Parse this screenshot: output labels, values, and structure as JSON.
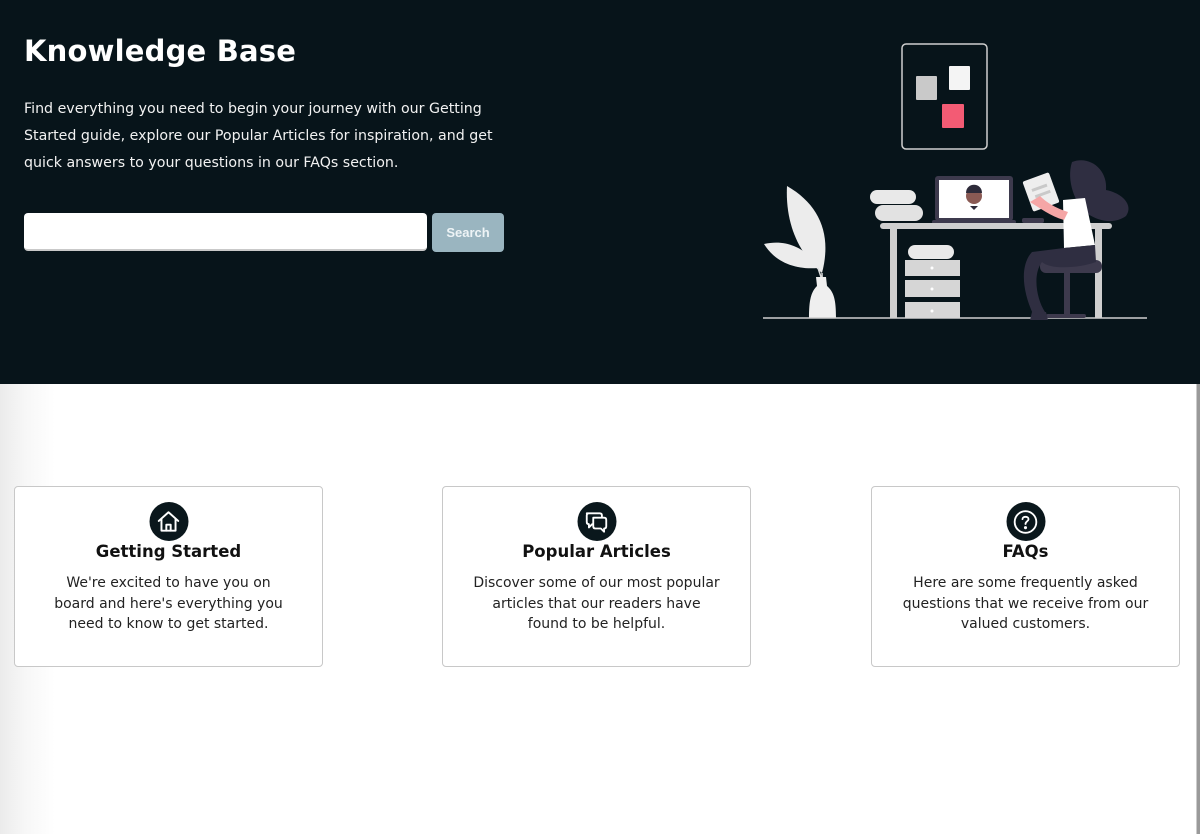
{
  "hero": {
    "title": "Knowledge Base",
    "description": "Find everything you need to begin your journey with our Getting Started guide, explore our Popular Articles for inspiration, and get quick answers to your questions in our FAQs section.",
    "search": {
      "value": "",
      "placeholder": "",
      "button_label": "Search"
    },
    "illustration": "person-working-at-desk-illustration"
  },
  "colors": {
    "hero_bg": "#07141a",
    "search_button_bg": "#9ab5c0",
    "accent_pink": "#f35b74",
    "icon_circle": "#0a171c"
  },
  "cards": [
    {
      "icon": "home-icon",
      "title": "Getting Started",
      "description": "We're excited to have you on board and here's everything you need to know to get started."
    },
    {
      "icon": "chat-bubbles-icon",
      "title": "Popular Articles",
      "description": "Discover some of our most popular articles that our readers have found to be helpful."
    },
    {
      "icon": "question-circle-icon",
      "title": "FAQs",
      "description": "Here are some frequently asked questions that we receive from our valued customers."
    }
  ]
}
